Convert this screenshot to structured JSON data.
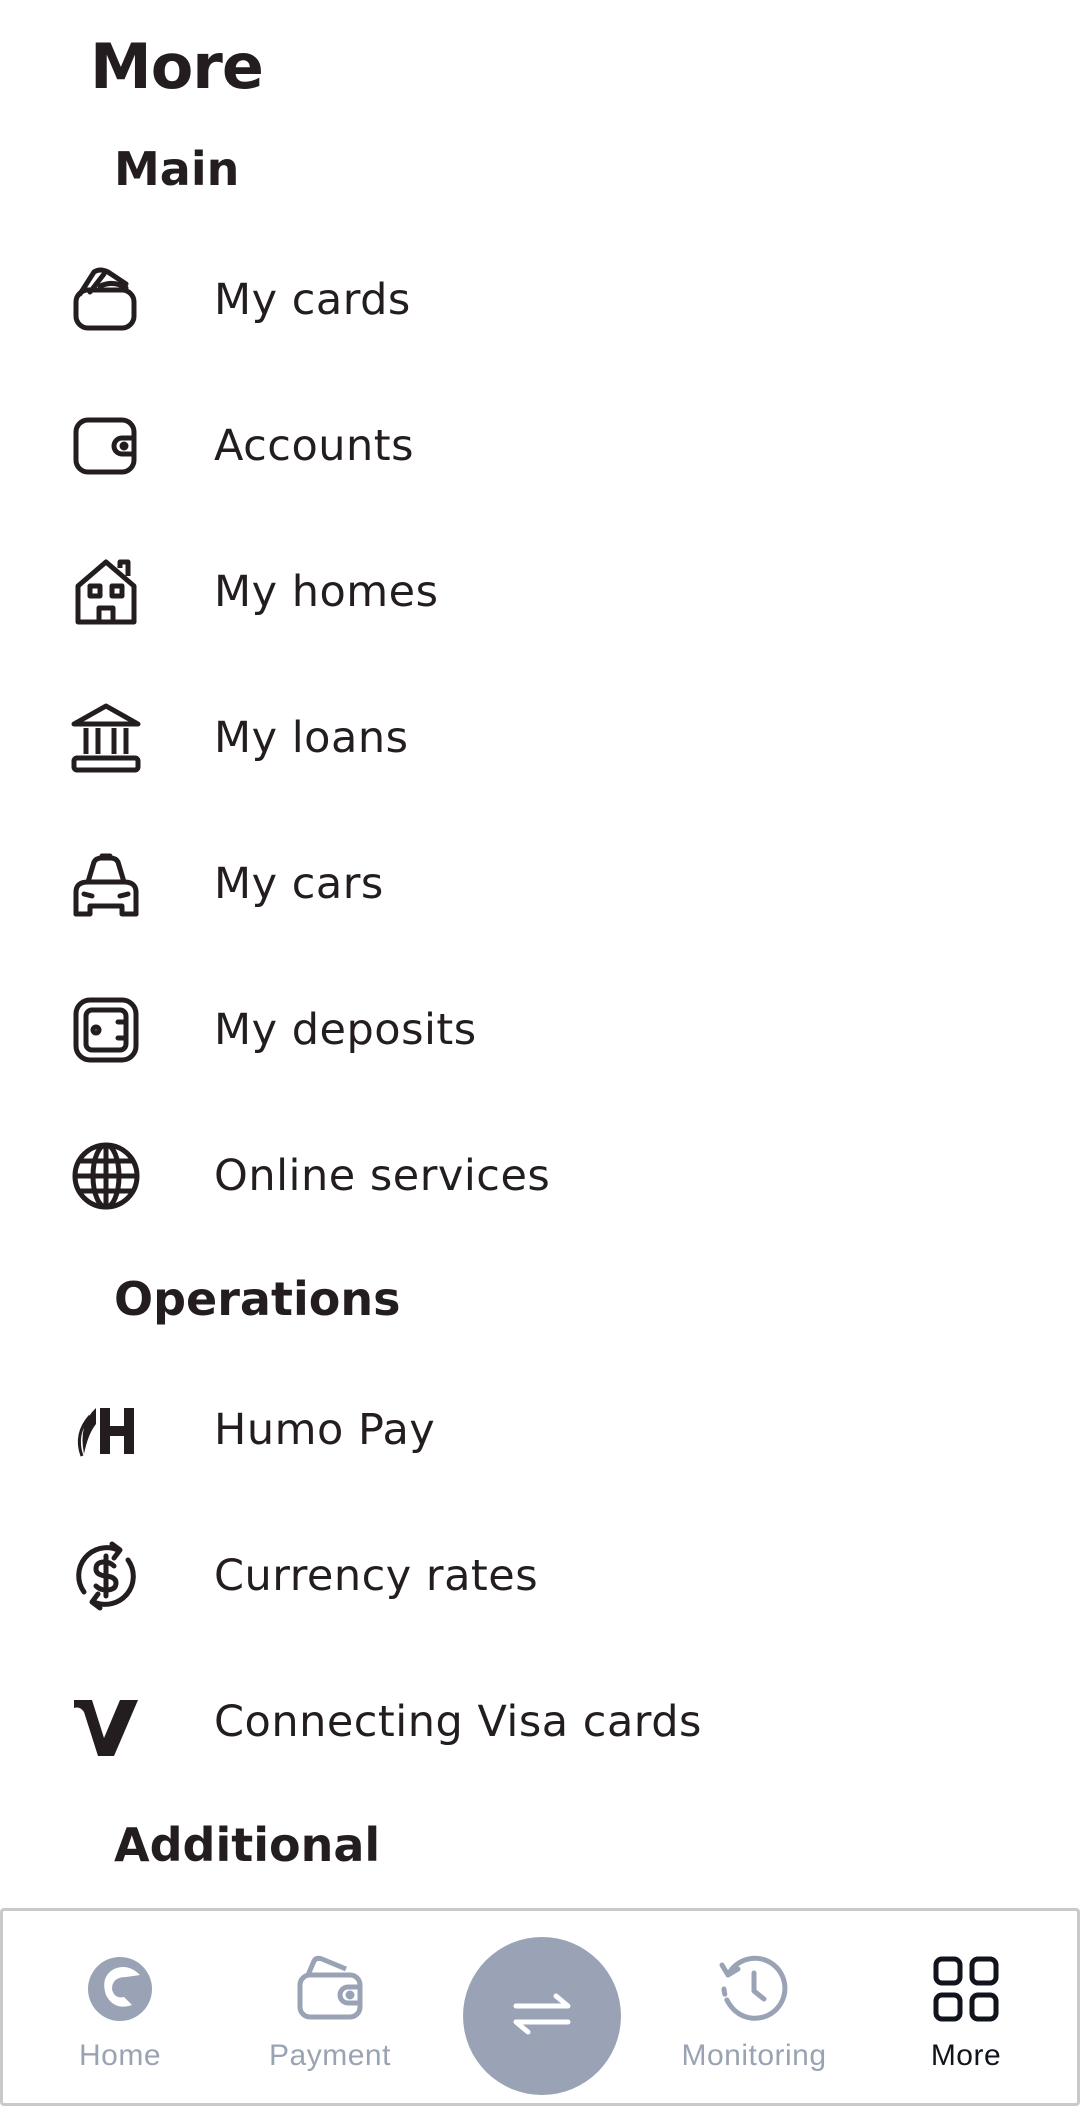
{
  "header": {
    "title": "More"
  },
  "sections": {
    "main": {
      "title": "Main",
      "items": [
        {
          "label": "My cards",
          "icon": "cards-icon"
        },
        {
          "label": "Accounts",
          "icon": "wallet-icon"
        },
        {
          "label": "My homes",
          "icon": "house-icon"
        },
        {
          "label": "My loans",
          "icon": "bank-icon"
        },
        {
          "label": "My cars",
          "icon": "car-icon"
        },
        {
          "label": "My deposits",
          "icon": "safe-icon"
        },
        {
          "label": "Online services",
          "icon": "globe-icon"
        }
      ]
    },
    "operations": {
      "title": "Operations",
      "items": [
        {
          "label": "Humo Pay",
          "icon": "humo-logo-icon"
        },
        {
          "label": "Currency rates",
          "icon": "currency-exchange-icon"
        },
        {
          "label": "Connecting Visa cards",
          "icon": "visa-logo-icon"
        }
      ]
    },
    "additional": {
      "title": "Additional"
    }
  },
  "bottom_nav": {
    "items": [
      {
        "label": "Home",
        "icon": "home-logo-icon",
        "active": false
      },
      {
        "label": "Payment",
        "icon": "wallet-icon",
        "active": false
      },
      {
        "label": "Monitoring",
        "icon": "history-icon",
        "active": false
      },
      {
        "label": "More",
        "icon": "grid-icon",
        "active": true
      }
    ],
    "center_button": {
      "icon": "transfer-arrows-icon"
    },
    "colors": {
      "inactive": "#9aa3b3",
      "active": "#11141c",
      "center_bg": "#9aa3b6"
    }
  }
}
